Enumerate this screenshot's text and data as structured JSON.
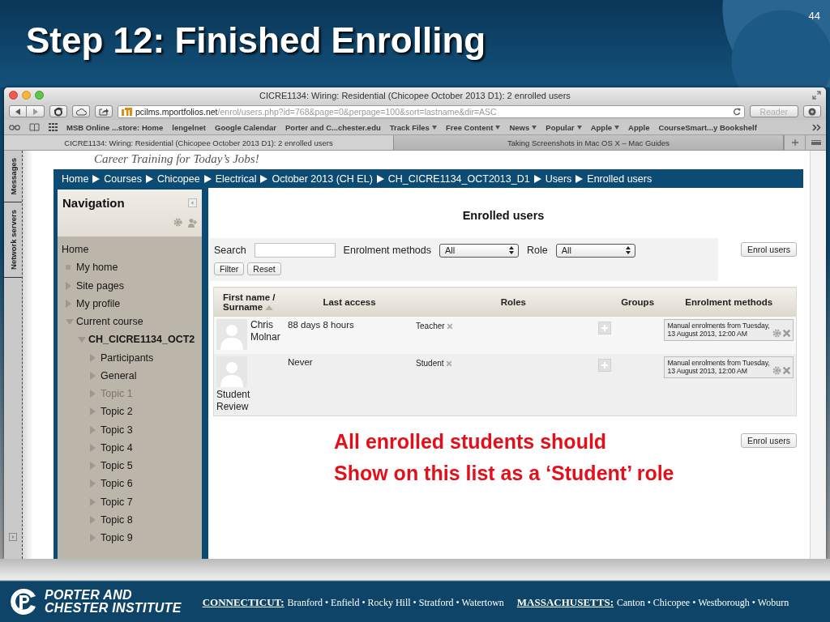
{
  "slide": {
    "title": "Step 12: Finished Enrolling",
    "page_number": "44"
  },
  "browser": {
    "title": "CICRE1134: Wiring: Residential (Chicopee October 2013 D1): 2 enrolled users",
    "url": {
      "host": "pcilms.mportfolios.net",
      "path": "/enrol/users.php?id=768&page=0&perpage=100&sort=lastname&dir=ASC"
    },
    "reader_button": {
      "label": "Reader",
      "disabled": true
    },
    "bookmarks": [
      {
        "label": "MSB Online ...store: Home",
        "has_menu": false
      },
      {
        "label": "lengelnet",
        "has_menu": false
      },
      {
        "label": "Google Calendar",
        "has_menu": false
      },
      {
        "label": "Porter and C...chester.edu",
        "has_menu": false
      },
      {
        "label": "Track Files",
        "has_menu": true
      },
      {
        "label": "Free Content",
        "has_menu": true
      },
      {
        "label": "News",
        "has_menu": true
      },
      {
        "label": "Popular",
        "has_menu": true
      },
      {
        "label": "Apple",
        "has_menu": true
      },
      {
        "label": "Apple",
        "has_menu": false
      },
      {
        "label": "CourseSmart...y Bookshelf",
        "has_menu": false
      }
    ],
    "tabs": [
      {
        "label": "CICRE1134: Wiring: Residential (Chicopee October 2013 D1): 2 enrolled users",
        "selected": true
      },
      {
        "label": "Taking Screenshots in Mac OS X – Mac Guides",
        "selected": false
      }
    ],
    "side_tabs": [
      "Messages",
      "Network servers"
    ]
  },
  "site": {
    "tagline": "Career Training for Today’s Jobs!",
    "breadcrumb": [
      "Home",
      "Courses",
      "Chicopee",
      "Electrical",
      "October 2013 (CH EL)",
      "CH_CICRE1134_OCT2013_D1",
      "Users",
      "Enrolled users"
    ],
    "navigation": {
      "title": "Navigation",
      "items": [
        {
          "label": "Home",
          "kind": "plain",
          "current": false,
          "disabled": false
        },
        {
          "label": "My home",
          "kind": "leaf",
          "current": false,
          "disabled": false
        },
        {
          "label": "Site pages",
          "kind": "branch",
          "expanded": false,
          "current": false,
          "disabled": false
        },
        {
          "label": "My profile",
          "kind": "branch",
          "expanded": false,
          "current": false,
          "disabled": false
        },
        {
          "label": "Current course",
          "kind": "branch",
          "expanded": true,
          "current": false,
          "disabled": false,
          "children": [
            {
              "label": "CH_CICRE1134_OCT2",
              "kind": "branch",
              "expanded": true,
              "current": true,
              "disabled": false,
              "children": [
                {
                  "label": "Participants",
                  "kind": "branch",
                  "expanded": false,
                  "current": false,
                  "disabled": false
                },
                {
                  "label": "General",
                  "kind": "branch",
                  "expanded": false,
                  "current": false,
                  "disabled": false
                },
                {
                  "label": "Topic 1",
                  "kind": "branch",
                  "expanded": false,
                  "current": false,
                  "disabled": true
                },
                {
                  "label": "Topic 2",
                  "kind": "branch",
                  "expanded": false,
                  "current": false,
                  "disabled": false
                },
                {
                  "label": "Topic 3",
                  "kind": "branch",
                  "expanded": false,
                  "current": false,
                  "disabled": false
                },
                {
                  "label": "Topic 4",
                  "kind": "branch",
                  "expanded": false,
                  "current": false,
                  "disabled": false
                },
                {
                  "label": "Topic 5",
                  "kind": "branch",
                  "expanded": false,
                  "current": false,
                  "disabled": false
                },
                {
                  "label": "Topic 6",
                  "kind": "branch",
                  "expanded": false,
                  "current": false,
                  "disabled": false
                },
                {
                  "label": "Topic 7",
                  "kind": "branch",
                  "expanded": false,
                  "current": false,
                  "disabled": false
                },
                {
                  "label": "Topic 8",
                  "kind": "branch",
                  "expanded": false,
                  "current": false,
                  "disabled": false
                },
                {
                  "label": "Topic 9",
                  "kind": "branch",
                  "expanded": false,
                  "current": false,
                  "disabled": false
                }
              ]
            }
          ]
        }
      ]
    },
    "page_heading": "Enrolled users",
    "filters": {
      "search_label": "Search",
      "enrolment_label": "Enrolment methods",
      "enrolment_value": "All",
      "role_label": "Role",
      "role_value": "All",
      "buttons": [
        "Filter",
        "Reset"
      ]
    },
    "enrol_button": "Enrol users",
    "table": {
      "columns": [
        {
          "label": "First name / Surname",
          "sorted": true
        },
        {
          "label": "Last access",
          "sorted": false
        },
        {
          "label": "Roles",
          "sorted": false
        },
        {
          "label": "Groups",
          "sorted": false
        },
        {
          "label": "Enrolment methods",
          "sorted": false
        }
      ],
      "rows": [
        {
          "name": "Chris Molnar",
          "last_access": "88 days 8 hours",
          "roles": [
            "Teacher"
          ],
          "enrolment": "Manual enrolments from Tuesday, 13 August 2013, 12:00 AM"
        },
        {
          "name": "Student Review",
          "last_access": "Never",
          "roles": [
            "Student"
          ],
          "enrolment": "Manual enrolments from Tuesday, 13 August 2013, 12:00 AM"
        }
      ]
    },
    "enrol_button_bottom": "Enrol users"
  },
  "callout": {
    "lines": [
      "All enrolled students should",
      "Show on this list as a ‘Student’ role"
    ]
  },
  "footer": {
    "brand_lines": [
      "PORTER AND",
      "CHESTER INSTITUTE"
    ],
    "regions": [
      {
        "state": "CONNECTICUT:",
        "cities": "Branford • Enfield • Rocky Hill • Stratford • Watertown"
      },
      {
        "state": "MASSACHUSETTS:",
        "cities": "Canton • Chicopee • Westborough • Woburn"
      }
    ]
  }
}
